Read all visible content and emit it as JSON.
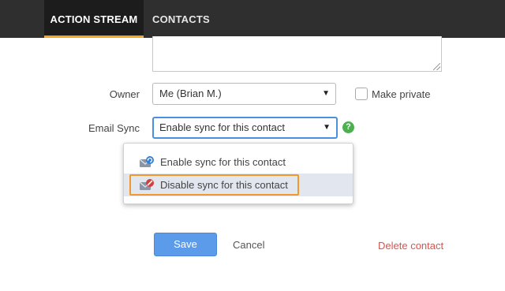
{
  "nav": {
    "tabs": [
      {
        "label": "ACTION STREAM"
      },
      {
        "label": "CONTACTS"
      }
    ],
    "accent_color": "#f5a623"
  },
  "form": {
    "owner": {
      "label": "Owner",
      "value": "Me (Brian M.)"
    },
    "make_private": {
      "label": "Make private",
      "checked": false
    },
    "email_sync": {
      "label": "Email Sync",
      "value": "Enable sync for this contact",
      "options": [
        {
          "label": "Enable sync for this contact",
          "icon": "envelope-sync-icon"
        },
        {
          "label": "Disable sync for this contact",
          "icon": "envelope-disabled-icon"
        }
      ],
      "help_icon_text": "?"
    }
  },
  "actions": {
    "save_label": "Save",
    "cancel_label": "Cancel",
    "delete_label": "Delete contact"
  },
  "colors": {
    "primary_button": "#5b9bea",
    "danger_link": "#d9534f",
    "focus_border": "#4a90e2",
    "highlight_box": "#f0982b"
  }
}
